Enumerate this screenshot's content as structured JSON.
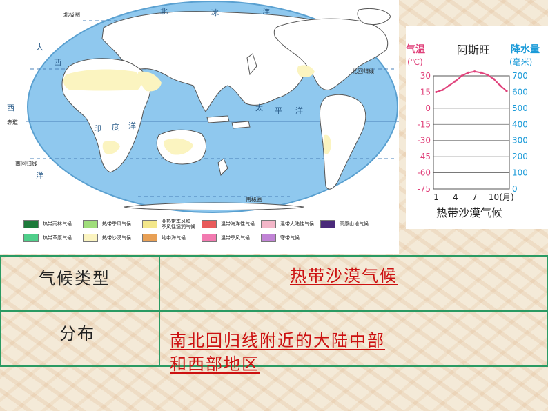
{
  "map": {
    "labels": {
      "north_polar_circle": "北极圈",
      "arctic_ocean": [
        "北",
        "冰",
        "洋"
      ],
      "tropic_of_cancer": "北回归线",
      "equator": "赤道",
      "tropic_of_capricorn": "南回归线",
      "south_polar_circle": "南极圈",
      "pacific_ocean": [
        "太",
        "平",
        "洋"
      ],
      "indian_ocean": [
        "印",
        "度",
        "洋"
      ],
      "atlantic_north": [
        "大",
        "西"
      ],
      "atlantic_west": "西",
      "atlantic_south": "洋"
    },
    "legend": [
      {
        "label": "热带雨林气候",
        "color": "#1d7a3a"
      },
      {
        "label": "热带季风气候",
        "color": "#9fdd7a"
      },
      {
        "label": "亚热带季风和\n季风性湿润气候",
        "color": "#f3e78a"
      },
      {
        "label": "温带海洋性气候",
        "color": "#e85a5a"
      },
      {
        "label": "温带大陆性气候",
        "color": "#f3b6c8"
      },
      {
        "label": "高原山地气候",
        "color": "#4a2a7a"
      },
      {
        "label": "热带草原气候",
        "color": "#4fcf8a"
      },
      {
        "label": "热带沙漠气候",
        "color": "#fbf4c0"
      },
      {
        "label": "地中海气候",
        "color": "#e8a055"
      },
      {
        "label": "温带季风气候",
        "color": "#f27ab0"
      },
      {
        "label": "寒带气候",
        "color": "#c184d6"
      }
    ]
  },
  "climate_chart": {
    "title": "阿斯旺",
    "temp_label_1": "气温",
    "temp_label_2": "(℃)",
    "precip_label_1": "降水量",
    "precip_label_2": "(毫米)",
    "temp_ticks": [
      "30",
      "15",
      "0",
      "-15",
      "-30",
      "-45",
      "-60",
      "-75"
    ],
    "precip_ticks": [
      "700",
      "600",
      "500",
      "400",
      "300",
      "200",
      "100",
      "0"
    ],
    "month_ticks": [
      "1",
      "4",
      "7",
      "10",
      "(月)"
    ],
    "caption": "热带沙漠气候"
  },
  "chart_data": {
    "type": "line",
    "title": "阿斯旺",
    "x": [
      1,
      2,
      3,
      4,
      5,
      6,
      7,
      8,
      9,
      10,
      11,
      12
    ],
    "series": [
      {
        "name": "气温",
        "values": [
          15,
          17,
          21,
          25,
          30,
          33,
          34,
          33,
          31,
          27,
          21,
          16
        ],
        "color": "#e0407a"
      }
    ],
    "precipitation": [
      0,
      0,
      0,
      0,
      0,
      0,
      0,
      0,
      0,
      0,
      0,
      0
    ],
    "ylabel": "气温(℃)",
    "ylabel_right": "降水量(毫米)",
    "xlabel": "(月)",
    "ylim": [
      -75,
      30
    ],
    "ylim_right": [
      0,
      700
    ],
    "grid": true
  },
  "table": {
    "row1_label": "气候类型",
    "row1_answer": "热带沙漠气候",
    "row2_label": "分布",
    "row2_answer_line1": "南北回归线附近的大陆中部",
    "row2_answer_line2": "和西部地区"
  }
}
